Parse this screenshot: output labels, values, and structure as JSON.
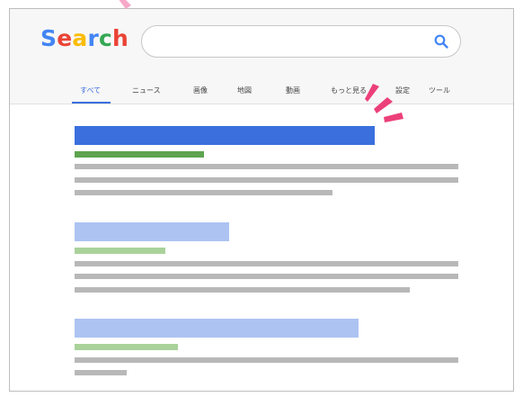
{
  "app": {
    "logo_letters": [
      {
        "char": "S",
        "color": "#4285F4"
      },
      {
        "char": "e",
        "color": "#EA4335"
      },
      {
        "char": "a",
        "color": "#FBBC05"
      },
      {
        "char": "r",
        "color": "#4285F4"
      },
      {
        "char": "c",
        "color": "#34A853"
      },
      {
        "char": "h",
        "color": "#EA4335"
      }
    ]
  },
  "search": {
    "value": "",
    "placeholder": "",
    "icon": "search-icon"
  },
  "tabs": [
    {
      "label": "すべて",
      "active": true
    },
    {
      "label": "ニュース",
      "active": false
    },
    {
      "label": "画像",
      "active": false
    },
    {
      "label": "地図",
      "active": false
    },
    {
      "label": "動画",
      "active": false
    },
    {
      "label": "もっと見る",
      "active": false
    },
    {
      "label": "設定",
      "active": false
    },
    {
      "label": "ツール",
      "active": false
    }
  ],
  "colors": {
    "accent_blue": "#3b6fde",
    "light_blue": "#adc3f2",
    "green": "#5ea34f",
    "light_green": "#a9d29b",
    "gray": "#b8b8b8",
    "sparkle": "#ec407a"
  },
  "results": [
    {
      "title_color": "#3b6fde",
      "url_color": "#5ea34f"
    },
    {
      "title_color": "#adc3f2",
      "url_color": "#a9d29b"
    },
    {
      "title_color": "#adc3f2",
      "url_color": "#a9d29b"
    }
  ]
}
